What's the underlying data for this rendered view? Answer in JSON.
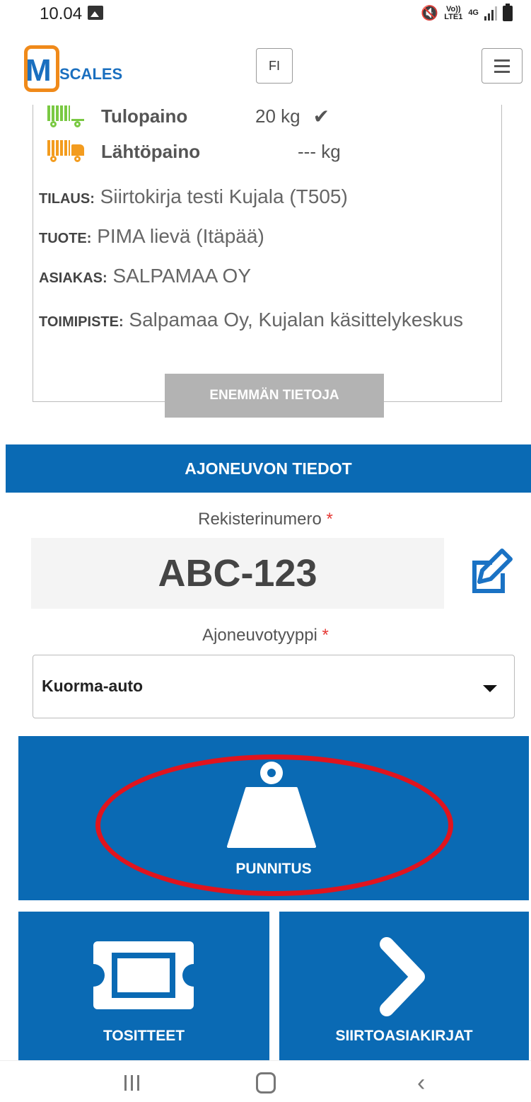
{
  "status_bar": {
    "time": "10.04",
    "volte_line1": "Vo))",
    "volte_line2": "LTE1",
    "network": "4G"
  },
  "header": {
    "logo_letter": "M",
    "logo_text": "SCALES",
    "language": "FI"
  },
  "weights": {
    "tulopaino_label": "Tulopaino",
    "tulopaino_value": "20 kg",
    "lahtopaino_label": "Lähtöpaino",
    "lahtopaino_value": "--- kg"
  },
  "details": {
    "tilaus_key": "TILAUS:",
    "tilaus_value": "Siirtokirja testi Kujala (T505)",
    "tuote_key": "TUOTE:",
    "tuote_value": "PIMA lievä (Itäpää)",
    "asiakas_key": "ASIAKAS:",
    "asiakas_value": "SALPAMAA OY",
    "toimipiste_key": "TOIMIPISTE:",
    "toimipiste_value": "Salpamaa Oy, Kujalan käsittelykeskus",
    "more_button": "ENEMMÄN TIETOJA"
  },
  "vehicle": {
    "section_title": "AJONEUVON TIEDOT",
    "plate_label": "Rekisterinumero",
    "plate_value": "ABC-123",
    "type_label": "Ajoneuvotyyppi",
    "type_value": "Kuorma-auto",
    "required_mark": "*"
  },
  "actions": {
    "punnitus": "PUNNITUS",
    "tositteet": "TOSITTEET",
    "siirtoasiakirjat": "SIIRTOASIAKIRJAT"
  },
  "colors": {
    "primary": "#0a6ab4",
    "accent_orange": "#f08a1a",
    "incoming_green": "#7ac943",
    "outgoing_orange": "#f39c1f",
    "highlight_red": "#e0141e",
    "button_grey": "#b3b3b3"
  },
  "icons": {
    "incoming": "truck-green-icon",
    "outgoing": "truck-orange-icon",
    "check": "checkmark-icon",
    "edit": "edit-icon",
    "weight": "weight-icon",
    "receipt": "ticket-icon",
    "next": "chevron-right-icon"
  }
}
